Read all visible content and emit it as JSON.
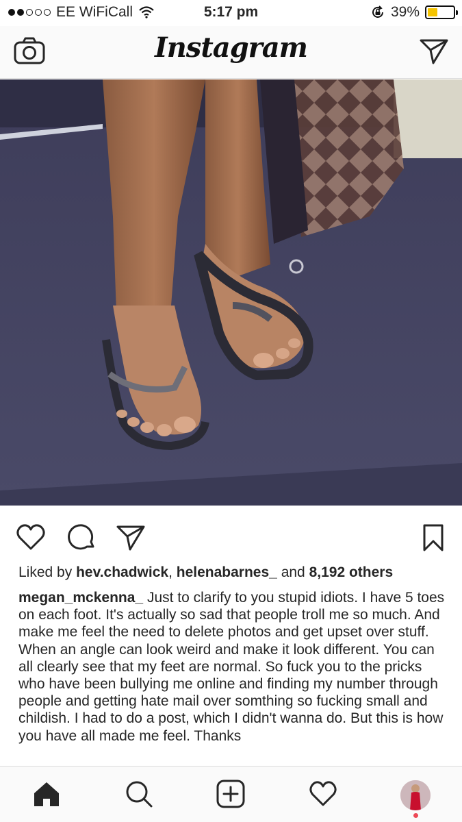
{
  "status_bar": {
    "carrier": "EE WiFiCall",
    "time": "5:17 pm",
    "battery_percent": "39%",
    "battery_level": 0.39,
    "signal_bars_filled": 2,
    "signal_bars_total": 5
  },
  "header": {
    "logo": "Instagram",
    "left_icon": "camera-icon",
    "right_icon": "direct-message-icon"
  },
  "post": {
    "likes": {
      "prefix": "Liked by",
      "user1": "hev.chadwick",
      "separator": ",",
      "user2": "helenabarnes_",
      "connector": "and",
      "others": "8,192 others"
    },
    "caption": {
      "username": "megan_mckenna_",
      "text": "Just to clarify to you stupid idiots. I have 5 toes on each foot. It's actually so sad that people troll me so much. And make me feel the need to delete photos and get upset over stuff. When an angle can look weird and make it look different. You can all clearly see that my feet are normal. So fuck you to the pricks who have been bullying me online and finding my number through people and getting hate mail over somthing so fucking small and childish. I had to do a post, which I didn't wanna do. But this is how you have all made me feel. Thanks"
    },
    "actions": [
      "heart-icon",
      "comment-icon",
      "share-icon",
      "bookmark-icon"
    ]
  },
  "tab_bar": {
    "items": [
      "home-icon",
      "search-icon",
      "add-post-icon",
      "activity-heart-icon",
      "profile-avatar"
    ]
  }
}
